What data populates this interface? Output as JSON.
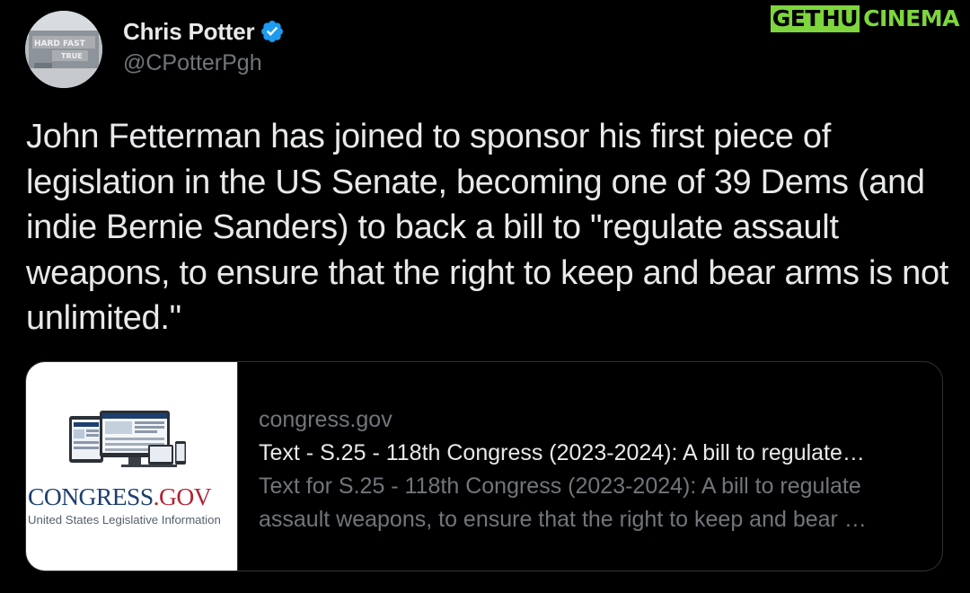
{
  "author": {
    "display_name": "Chris Potter",
    "handle": "@CPotterPgh",
    "verified": true,
    "verified_color": "#1d9bf0"
  },
  "tweet": {
    "text": "John Fetterman has joined to sponsor his first piece of legislation in the US Senate, becoming one of 39 Dems (and indie Bernie Sanders) to back a bill to \"regulate assault weapons, to ensure that the right to keep and bear arms is not unlimited.\""
  },
  "link_card": {
    "domain": "congress.gov",
    "title": "Text - S.25 - 118th Congress (2023-2024): A bill to regulate…",
    "description": "Text for S.25 - 118th Congress (2023-2024): A bill to regulate assault weapons, to ensure that the right to keep and bear …",
    "thumbnail": {
      "logo_main": "CONGRESS",
      "logo_suffix": ".GOV",
      "tagline": "United States Legislative Information"
    }
  },
  "watermark": {
    "part1": "GET",
    "part2": "HU",
    "part3": "CINEMA",
    "color": "#7fd53d"
  },
  "avatar_sign_text": "HARD FAST TRUE",
  "colors": {
    "background": "#000000",
    "primary_text": "#e7e9ea",
    "secondary_text": "#71767b",
    "border": "#2f3336"
  }
}
